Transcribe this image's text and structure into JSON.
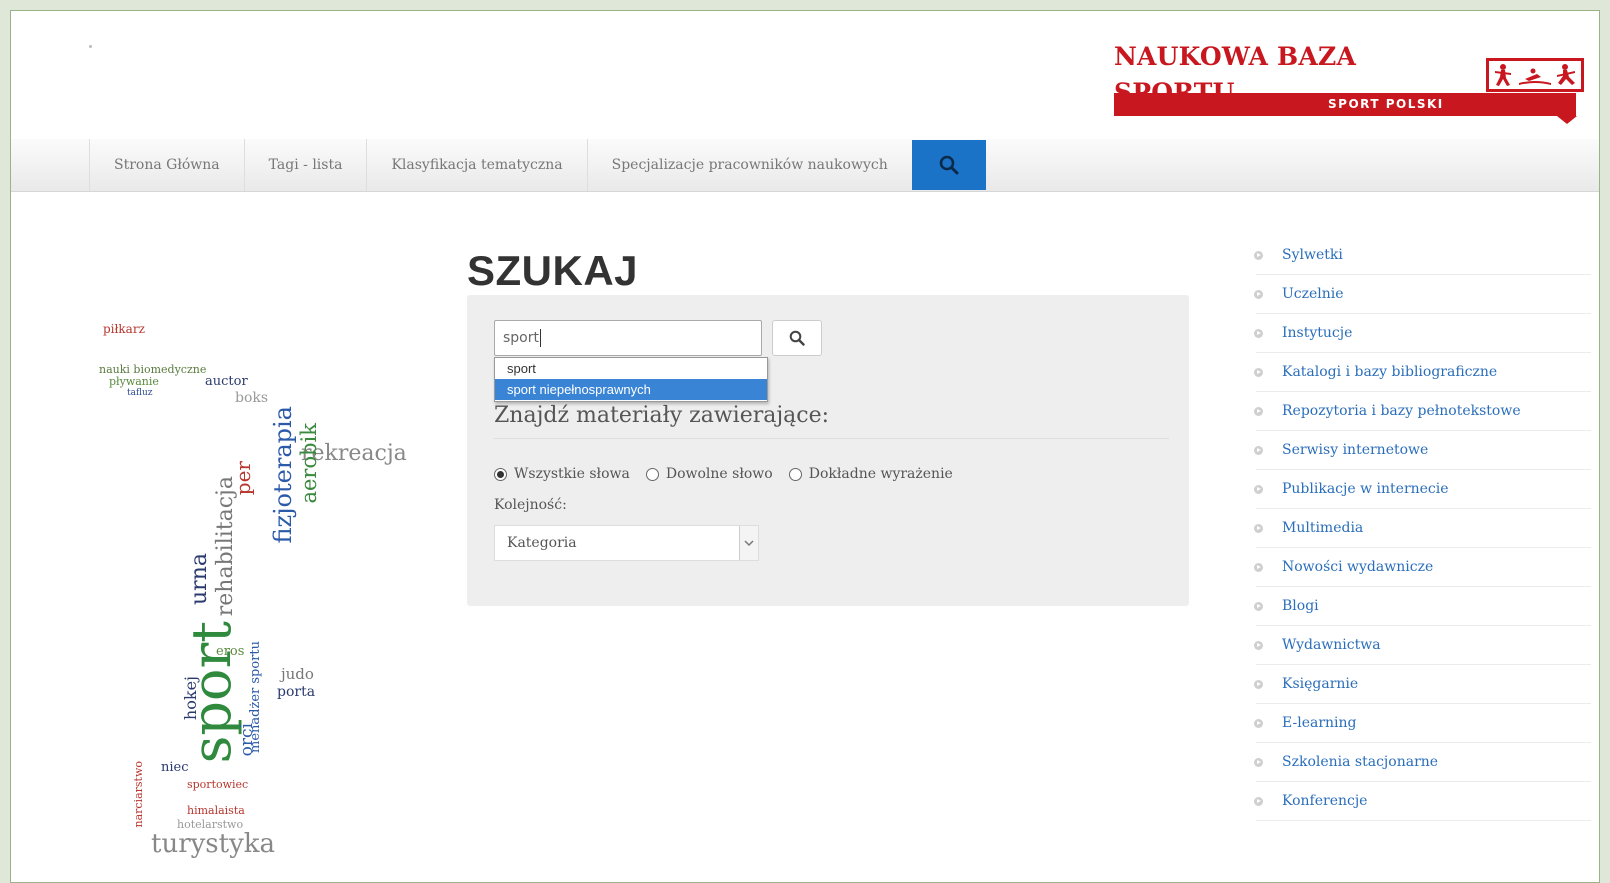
{
  "logo": {
    "title": "NAUKOWA BAZA SPORTU",
    "subtitle": "SPORT POLSKI",
    "brand_color": "#c8171e"
  },
  "nav": {
    "items": [
      {
        "label": "Strona Główna"
      },
      {
        "label": "Tagi - lista"
      },
      {
        "label": "Klasyfikacja tematyczna"
      },
      {
        "label": "Specjalizacje pracowników naukowych"
      }
    ],
    "search_icon": "search-icon",
    "search_color": "#1a73c7"
  },
  "cloud": {
    "words": [
      "piłkarz",
      "nauki biomedyczne",
      "pływanie",
      "tafluz",
      "auctor",
      "boks",
      "rekreacja",
      "fizjoterapia",
      "aerobik",
      "rehabilitacja",
      "per",
      "urna",
      "sport",
      "hokej",
      "eros",
      "judo",
      "porta",
      "menadżer sportu",
      "orci",
      "turystyka",
      "himalaista",
      "hotelarstwo",
      "sportowiec",
      "narciarstwo",
      "niec"
    ]
  },
  "main": {
    "title": "SZUKAJ",
    "search": {
      "value": "sport",
      "button_icon": "search-icon"
    },
    "autocomplete": [
      {
        "label": "sport"
      },
      {
        "label": "sport niepełnosprawnych"
      }
    ],
    "find_heading": "Znajdź materiały zawierające:",
    "radios": [
      {
        "label": "Wszystkie słowa",
        "checked": true
      },
      {
        "label": "Dowolne słowo",
        "checked": false
      },
      {
        "label": "Dokładne wyrażenie",
        "checked": false
      }
    ],
    "order_label": "Kolejność:",
    "order_value": "Kategoria"
  },
  "sidebar": {
    "items": [
      {
        "label": "Sylwetki"
      },
      {
        "label": "Uczelnie"
      },
      {
        "label": "Instytucje"
      },
      {
        "label": "Katalogi i bazy bibliograficzne"
      },
      {
        "label": "Repozytoria i bazy pełnotekstowe"
      },
      {
        "label": "Serwisy internetowe"
      },
      {
        "label": "Publikacje w internecie"
      },
      {
        "label": "Multimedia"
      },
      {
        "label": "Nowości wydawnicze"
      },
      {
        "label": "Blogi"
      },
      {
        "label": "Wydawnictwa"
      },
      {
        "label": "Księgarnie"
      },
      {
        "label": "E-learning"
      },
      {
        "label": "Szkolenia stacjonarne"
      },
      {
        "label": "Konferencje"
      }
    ]
  }
}
